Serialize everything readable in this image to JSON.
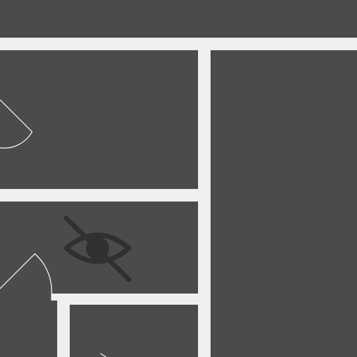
{
  "colors": {
    "floor": "#4b4b4b",
    "wall": "#efefef",
    "door_swing": "#ffffff",
    "icon": "#303030"
  },
  "icons": {
    "visibility": "eye-off-icon"
  }
}
